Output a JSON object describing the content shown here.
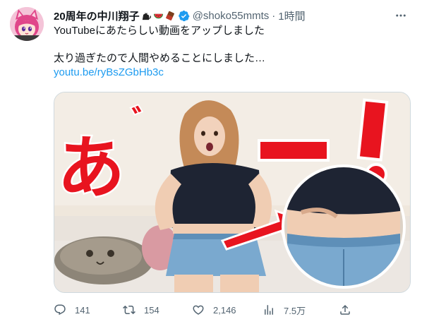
{
  "author": {
    "display_name": "20周年の中川翔子",
    "handle": "@shoko55mmts",
    "time": "1時間",
    "name_emojis": [
      "black-cat-emoji",
      "watermelon-emoji",
      "chocolate-bar-emoji"
    ],
    "verified": true
  },
  "tweet": {
    "line1": "YouTubeにあたらしい動画をアップしました",
    "line2": "太り過ぎたので人間やめることにしました…",
    "link": "youtu.be/ryBsZGbHb3c"
  },
  "media": {
    "overlay_text": "あ゛ーー！",
    "accent_color": "#e8141f"
  },
  "actions": {
    "replies": "141",
    "retweets": "154",
    "likes": "2,146",
    "views": "7.5万"
  },
  "icons": [
    "more-icon",
    "reply-icon",
    "retweet-icon",
    "like-icon",
    "views-icon",
    "share-icon"
  ]
}
